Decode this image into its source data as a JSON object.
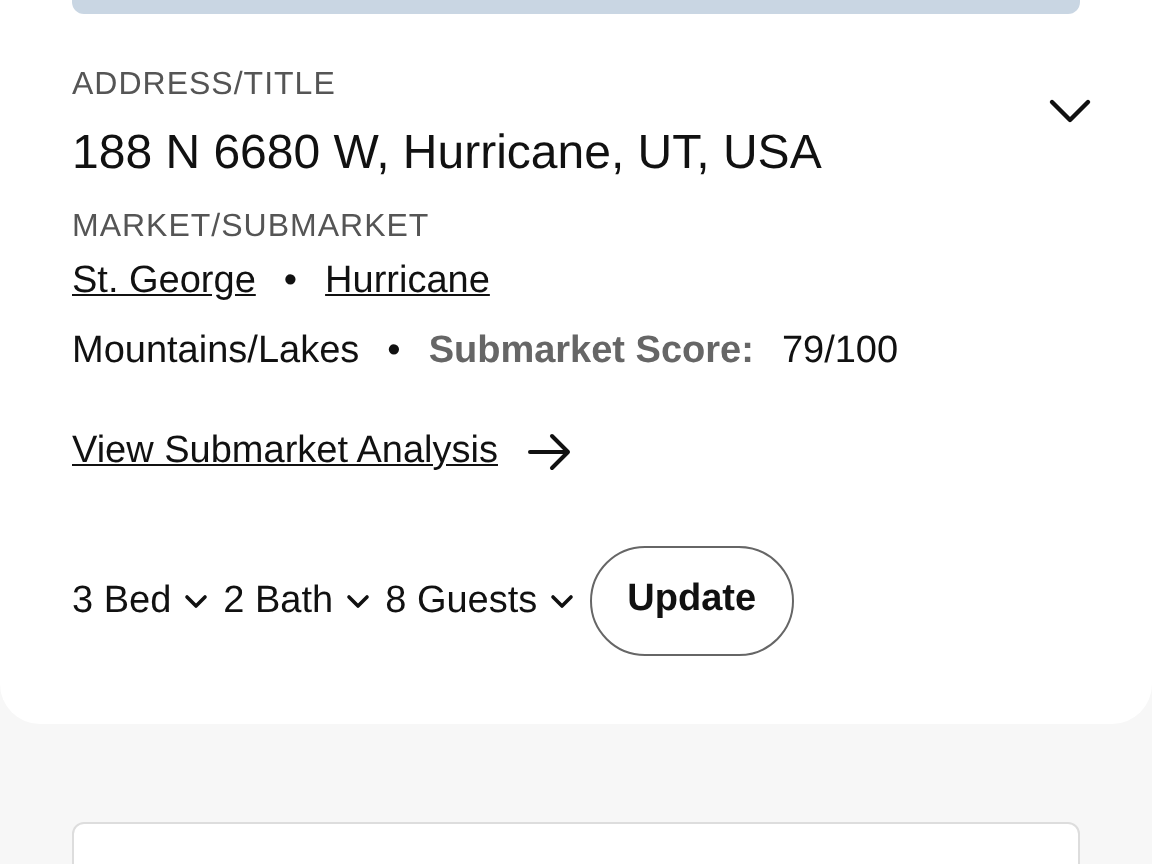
{
  "address": {
    "label": "ADDRESS/TITLE",
    "value": "188 N 6680 W, Hurricane, UT, USA",
    "expanded": false
  },
  "market": {
    "label": "MARKET/SUBMARKET",
    "links": [
      "St. George",
      "Hurricane"
    ],
    "separator": "•"
  },
  "category": {
    "name": "Mountains/Lakes",
    "separator": "•",
    "score_label": "Submarket Score:",
    "score": "79/100"
  },
  "analysis_link": "View Submarket Analysis",
  "filters": [
    {
      "label": "3 Bed"
    },
    {
      "label": "2 Bath"
    },
    {
      "label": "8 Guests"
    }
  ],
  "update_button": "Update"
}
